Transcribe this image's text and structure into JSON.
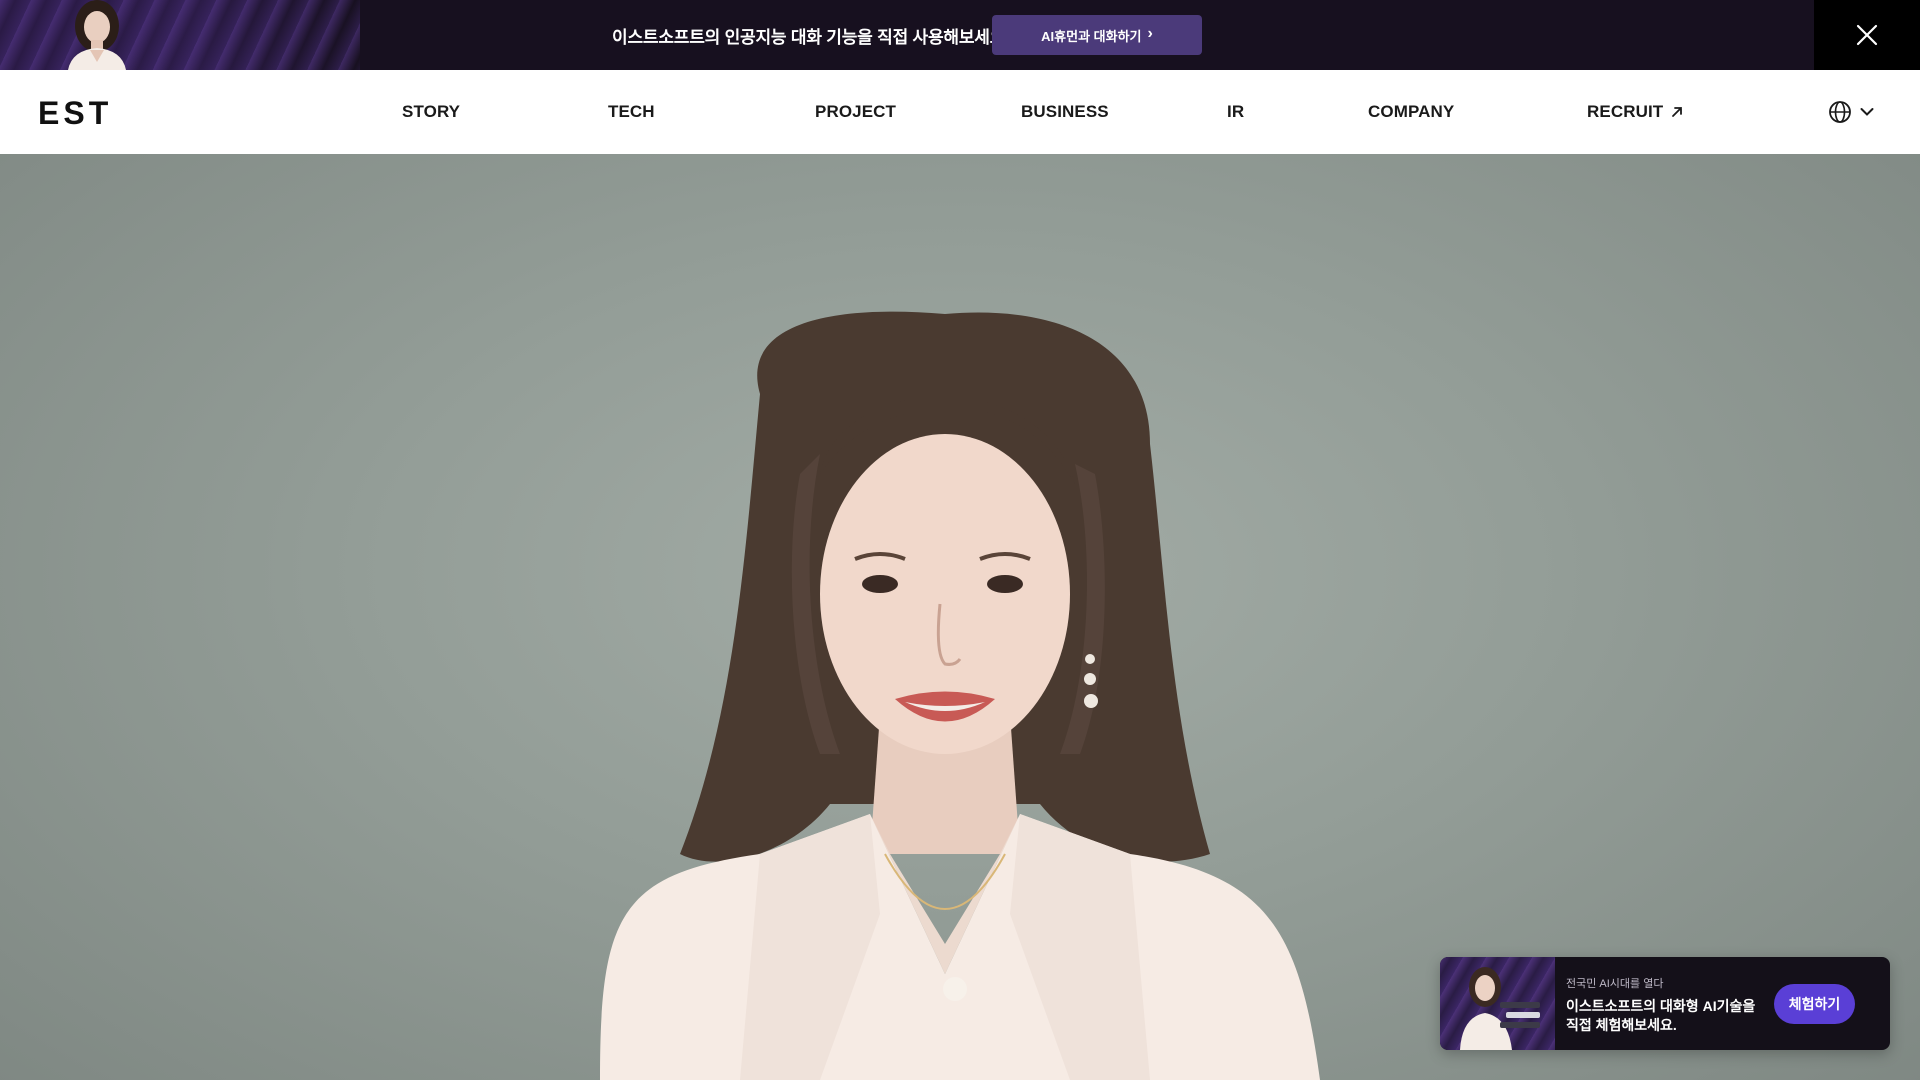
{
  "promo_bar": {
    "message": "이스트소프트의 인공지능 대화 기능을 직접 사용해보세요.",
    "cta_label": "AI휴먼과 대화하기",
    "cta_icon": "chevron-right-icon",
    "close_icon": "close-icon"
  },
  "header": {
    "logo_text": "EST",
    "nav": [
      {
        "label": "STORY"
      },
      {
        "label": "TECH"
      },
      {
        "label": "PROJECT"
      },
      {
        "label": "BUSINESS"
      },
      {
        "label": "IR"
      },
      {
        "label": "COMPANY"
      },
      {
        "label": "RECRUIT",
        "icon": "external-arrow-icon"
      }
    ],
    "language_icon": "globe-icon",
    "language_dropdown_icon": "chevron-down-icon"
  },
  "floating_card": {
    "subtitle": "전국민 AI시대를 열다",
    "title": "이스트소프트의 대화형 AI기술을 직접 체험해보세요.",
    "button_label": "체험하기"
  },
  "colors": {
    "promo_bg": "#17101f",
    "promo_button": "#4b3a7a",
    "card_button": "#5a3fd6",
    "hero_bg": "#939d97"
  }
}
